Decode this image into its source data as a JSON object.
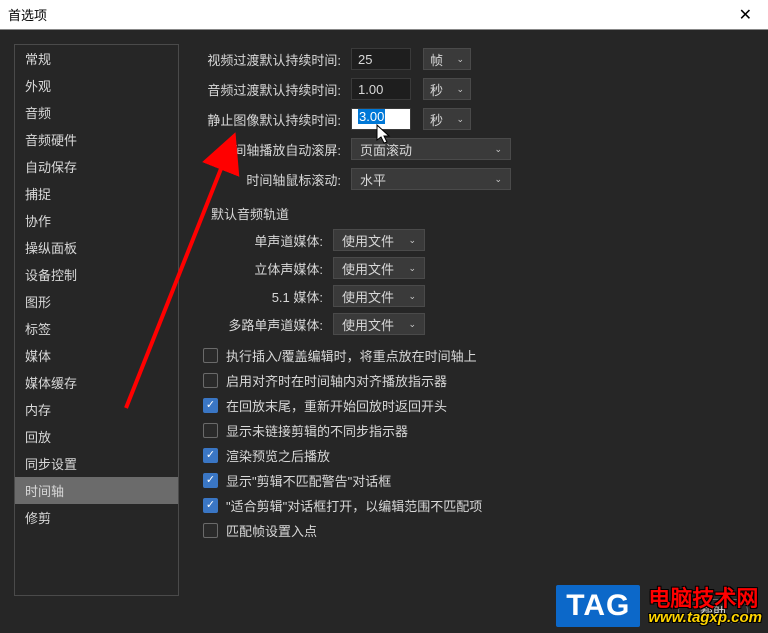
{
  "title": "首选项",
  "sidebar": {
    "items": [
      {
        "label": "常规"
      },
      {
        "label": "外观"
      },
      {
        "label": "音频"
      },
      {
        "label": "音频硬件"
      },
      {
        "label": "自动保存"
      },
      {
        "label": "捕捉"
      },
      {
        "label": "协作"
      },
      {
        "label": "操纵面板"
      },
      {
        "label": "设备控制"
      },
      {
        "label": "图形"
      },
      {
        "label": "标签"
      },
      {
        "label": "媒体"
      },
      {
        "label": "媒体缓存"
      },
      {
        "label": "内存"
      },
      {
        "label": "回放"
      },
      {
        "label": "同步设置"
      },
      {
        "label": "时间轴"
      },
      {
        "label": "修剪"
      }
    ],
    "active_index": 16
  },
  "settings": {
    "video_transition": {
      "label": "视频过渡默认持续时间:",
      "value": "25",
      "unit": "帧"
    },
    "audio_transition": {
      "label": "音频过渡默认持续时间:",
      "value": "1.00",
      "unit": "秒"
    },
    "still_image": {
      "label": "静止图像默认持续时间:",
      "value": "3.00",
      "unit": "秒"
    },
    "playback_autoscroll": {
      "label": "时间轴播放自动滚屏:",
      "value": "页面滚动"
    },
    "mouse_scroll": {
      "label": "时间轴鼠标滚动:",
      "value": "水平"
    }
  },
  "audio_tracks": {
    "title": "默认音频轨道",
    "mono": {
      "label": "单声道媒体:",
      "value": "使用文件"
    },
    "stereo": {
      "label": "立体声媒体:",
      "value": "使用文件"
    },
    "fiveone": {
      "label": "5.1 媒体:",
      "value": "使用文件"
    },
    "multimono": {
      "label": "多路单声道媒体:",
      "value": "使用文件"
    }
  },
  "checkboxes": [
    {
      "label": "执行插入/覆盖编辑时，将重点放在时间轴上",
      "checked": false
    },
    {
      "label": "启用对齐时在时间轴内对齐播放指示器",
      "checked": false
    },
    {
      "label": "在回放末尾，重新开始回放时返回开头",
      "checked": true
    },
    {
      "label": "显示未链接剪辑的不同步指示器",
      "checked": false
    },
    {
      "label": "渲染预览之后播放",
      "checked": true
    },
    {
      "label": "显示\"剪辑不匹配警告\"对话框",
      "checked": true
    },
    {
      "label": "\"适合剪辑\"对话框打开，以编辑范围不匹配项",
      "checked": true
    },
    {
      "label": "匹配帧设置入点",
      "checked": false
    }
  ],
  "buttons": {
    "help": "帮助"
  },
  "watermark": {
    "brand": "TAG",
    "cn": "电脑技术网",
    "url": "www.tagxp.com"
  }
}
